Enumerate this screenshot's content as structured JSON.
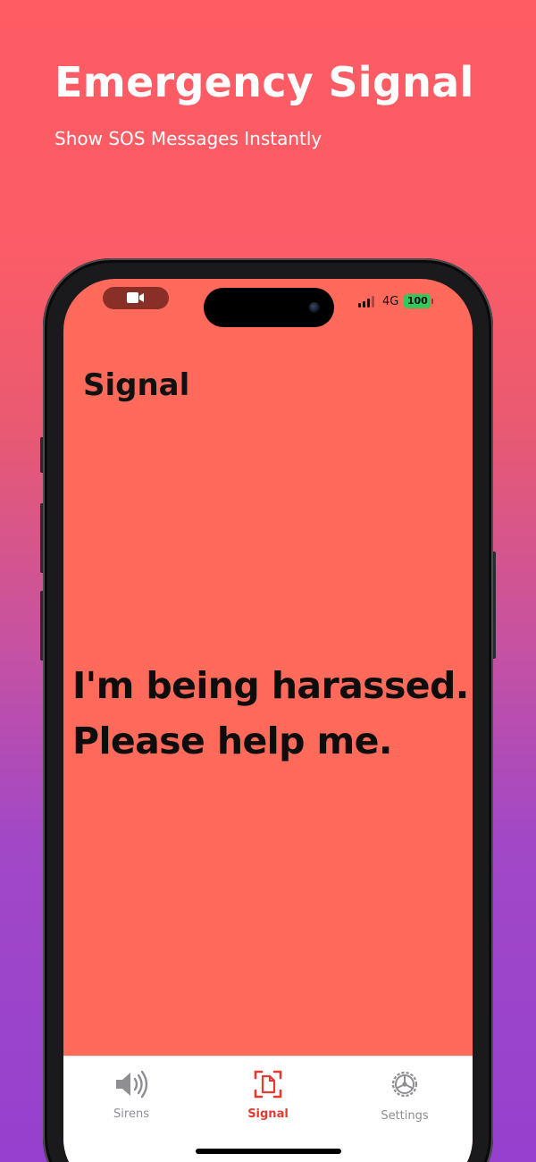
{
  "promo": {
    "title": "Emergency Signal",
    "subtitle": "Show SOS Messages Instantly"
  },
  "status_bar": {
    "network": "4G",
    "battery": "100",
    "battery_color": "#34c759",
    "signal_bars_active": 3,
    "signal_bars_total": 4
  },
  "screen": {
    "title": "Signal",
    "message_lines": [
      "I'm being harassed.",
      "Please help me."
    ],
    "background_color": "#ff6a5a"
  },
  "tab_bar": {
    "tabs": [
      {
        "label": "Sirens",
        "icon": "speaker-wave-icon",
        "selected": false
      },
      {
        "label": "Signal",
        "icon": "document-scan-icon",
        "selected": true
      },
      {
        "label": "Settings",
        "icon": "gear-icon",
        "selected": false
      }
    ],
    "active_color": "#e53a31",
    "inactive_color": "#8e8e93"
  }
}
